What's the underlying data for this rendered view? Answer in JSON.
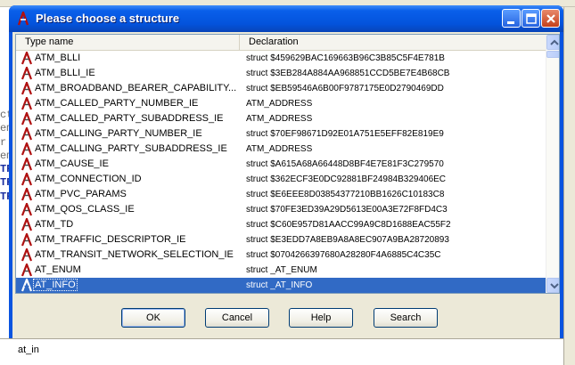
{
  "dialog": {
    "title": "Please choose a structure",
    "columns": {
      "type_name": "Type name",
      "declaration": "Declaration"
    },
    "rows": [
      {
        "name": "ATM_BLLI",
        "decl": "struct $459629BAC169663B96C3B85C5F4E781B"
      },
      {
        "name": "ATM_BLLI_IE",
        "decl": "struct $3EB284A884AA968851CCD5BE7E4B68CB"
      },
      {
        "name": "ATM_BROADBAND_BEARER_CAPABILITY...",
        "decl": "struct $EB59546A6B00F9787175E0D2790469DD"
      },
      {
        "name": "ATM_CALLED_PARTY_NUMBER_IE",
        "decl": "ATM_ADDRESS"
      },
      {
        "name": "ATM_CALLED_PARTY_SUBADDRESS_IE",
        "decl": "ATM_ADDRESS"
      },
      {
        "name": "ATM_CALLING_PARTY_NUMBER_IE",
        "decl": "struct $70EF98671D92E01A751E5EFF82E819E9"
      },
      {
        "name": "ATM_CALLING_PARTY_SUBADDRESS_IE",
        "decl": "ATM_ADDRESS"
      },
      {
        "name": "ATM_CAUSE_IE",
        "decl": "struct $A615A68A66448D8BF4E7E81F3C279570"
      },
      {
        "name": "ATM_CONNECTION_ID",
        "decl": "struct $362ECF3E0DC92881BF24984B329406EC"
      },
      {
        "name": "ATM_PVC_PARAMS",
        "decl": "struct $E6EEE8D03854377210BB1626C10183C8"
      },
      {
        "name": "ATM_QOS_CLASS_IE",
        "decl": "struct $70FE3ED39A29D5613E00A3E72F8FD4C3"
      },
      {
        "name": "ATM_TD",
        "decl": "struct $C60E957D81AACC99A9C8D1688EAC55F2"
      },
      {
        "name": "ATM_TRAFFIC_DESCRIPTOR_IE",
        "decl": "struct $E3EDD7A8EB9A8A8EC907A9BA28720893"
      },
      {
        "name": "ATM_TRANSIT_NETWORK_SELECTION_IE",
        "decl": "struct $0704266397680A28280F4A6885C4C35C"
      },
      {
        "name": "AT_ENUM",
        "decl": "struct _AT_ENUM"
      },
      {
        "name": "AT_INFO",
        "decl": "struct _AT_INFO",
        "selected": true
      }
    ],
    "buttons": {
      "ok": "OK",
      "cancel": "Cancel",
      "help": "Help",
      "search": "Search"
    }
  },
  "background": {
    "status_text": "at_in",
    "code_lines": [
      "ct",
      "em",
      "r",
      "em",
      "TR",
      "TR",
      "TR"
    ]
  },
  "colors": {
    "selection": "#316ac5",
    "titlebar": "#0353dc",
    "dialog_face": "#ece9d8"
  }
}
